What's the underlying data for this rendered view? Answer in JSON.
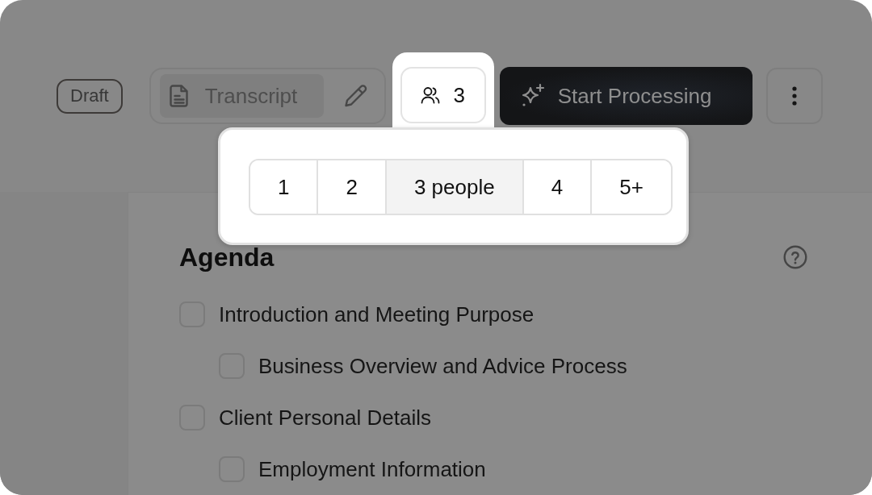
{
  "header": {
    "status_badge": "Draft",
    "transcript": {
      "label": "Transcript",
      "selected": true
    },
    "participants_button": {
      "label": "3",
      "highlighted": true
    },
    "process_button": {
      "label": "Start Processing"
    }
  },
  "participants_popover": {
    "options": [
      {
        "label": "1",
        "selected": false
      },
      {
        "label": "2",
        "selected": false
      },
      {
        "label": "3 people",
        "selected": true
      },
      {
        "label": "4",
        "selected": false
      },
      {
        "label": "5+",
        "selected": false
      }
    ]
  },
  "agenda": {
    "title": "Agenda",
    "items": [
      {
        "label": "Introduction and Meeting Purpose",
        "checked": false,
        "children": [
          {
            "label": "Business Overview and Advice Process",
            "checked": false
          }
        ]
      },
      {
        "label": "Client Personal Details",
        "checked": false,
        "children": [
          {
            "label": "Employment Information",
            "checked": false
          }
        ]
      }
    ]
  }
}
